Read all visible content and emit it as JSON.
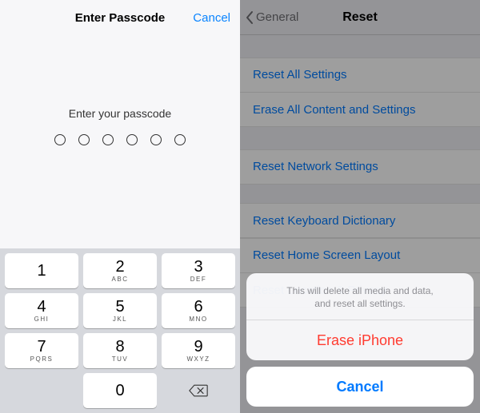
{
  "left": {
    "nav_title": "Enter Passcode",
    "nav_right": "Cancel",
    "prompt": "Enter your passcode",
    "passcode_length": 6,
    "keypad": {
      "keys": [
        {
          "num": "1",
          "sub": ""
        },
        {
          "num": "2",
          "sub": "ABC"
        },
        {
          "num": "3",
          "sub": "DEF"
        },
        {
          "num": "4",
          "sub": "GHI"
        },
        {
          "num": "5",
          "sub": "JKL"
        },
        {
          "num": "6",
          "sub": "MNO"
        },
        {
          "num": "7",
          "sub": "PQRS"
        },
        {
          "num": "8",
          "sub": "TUV"
        },
        {
          "num": "9",
          "sub": "WXYZ"
        },
        {
          "num": "0",
          "sub": ""
        }
      ]
    }
  },
  "right": {
    "back_label": "General",
    "nav_title": "Reset",
    "groups": [
      [
        "Reset All Settings",
        "Erase All Content and Settings"
      ],
      [
        "Reset Network Settings"
      ],
      [
        "Reset Keyboard Dictionary",
        "Reset Home Screen Layout",
        "Reset Location & Privacy"
      ]
    ],
    "sheet": {
      "message_line1": "This will delete all media and data,",
      "message_line2": "and reset all settings.",
      "destructive": "Erase iPhone",
      "cancel": "Cancel"
    }
  }
}
